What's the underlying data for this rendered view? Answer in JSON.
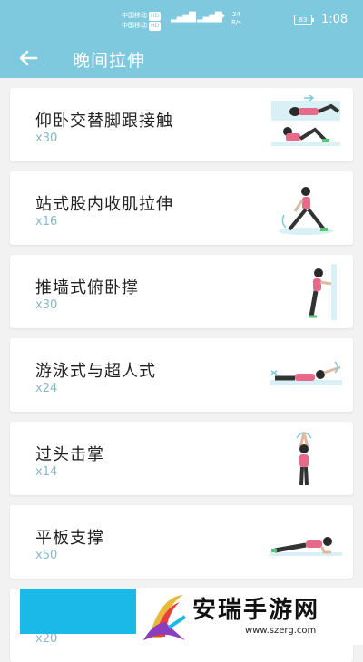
{
  "status_bar": {
    "carrier1": "中国移动",
    "carrier2": "中国移动",
    "hd": "HD",
    "speed_value": "24",
    "speed_unit": "B/s",
    "battery": "83",
    "time": "1:08"
  },
  "header": {
    "title": "晚间拉伸"
  },
  "exercises": [
    {
      "name": "仰卧交替脚跟接触",
      "count": "x30",
      "thumb": "lying-heel-touch"
    },
    {
      "name": "站式股内收肌拉伸",
      "count": "x16",
      "thumb": "standing-adductor-stretch"
    },
    {
      "name": "推墙式俯卧撑",
      "count": "x30",
      "thumb": "wall-pushup"
    },
    {
      "name": "游泳式与超人式",
      "count": "x24",
      "thumb": "swimmer-superman"
    },
    {
      "name": "过头击掌",
      "count": "x14",
      "thumb": "overhead-clap"
    },
    {
      "name": "平板支撑",
      "count": "x50",
      "thumb": "plank"
    },
    {
      "name": "",
      "count": "x20",
      "thumb": ""
    }
  ],
  "watermark": {
    "title": "安瑞手游网",
    "url": "www.szerg.com"
  },
  "colors": {
    "accent": "#7ec9de",
    "count_text": "#8bb8c8",
    "block": "#1ab9e8"
  }
}
